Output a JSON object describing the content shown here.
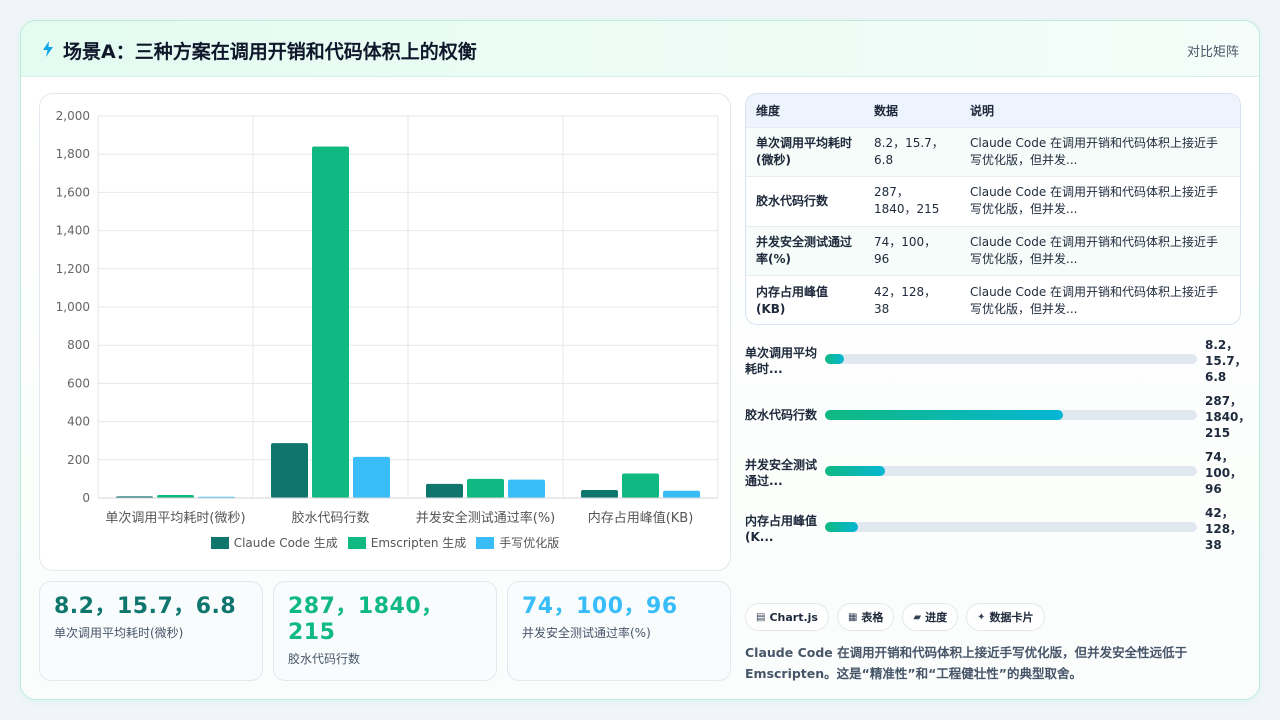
{
  "header": {
    "icon": "lightning-icon",
    "title": "场景A：三种方案在调用开销和代码体积上的权衡",
    "tag": "对比矩阵"
  },
  "colors": {
    "series": [
      "#0f766e",
      "#10b981",
      "#38bdf8"
    ],
    "stat_values": [
      "#0f766e",
      "#10b981",
      "#38bdf8"
    ],
    "accent": "#10b981"
  },
  "chart_data": {
    "type": "bar",
    "categories": [
      "单次调用平均耗时(微秒)",
      "胶水代码行数",
      "并发安全测试通过率(%)",
      "内存占用峰值(KB)"
    ],
    "series": [
      {
        "name": "Claude Code 生成",
        "values": [
          8.2,
          287,
          74,
          42
        ]
      },
      {
        "name": "Emscripten 生成",
        "values": [
          15.7,
          1840,
          100,
          128
        ]
      },
      {
        "name": "手写优化版",
        "values": [
          6.8,
          215,
          96,
          38
        ]
      }
    ],
    "ylim": [
      0,
      2000
    ],
    "yticks": [
      0,
      200,
      400,
      600,
      800,
      1000,
      1200,
      1400,
      1600,
      1800,
      2000
    ],
    "ytick_labels": [
      "0",
      "200",
      "400",
      "600",
      "800",
      "1,000",
      "1,200",
      "1,400",
      "1,600",
      "1,800",
      "2,000"
    ],
    "grid": true,
    "legend": "bottom"
  },
  "stats": [
    {
      "value": "8.2，15.7，6.8",
      "label": "单次调用平均耗时(微秒)"
    },
    {
      "value": "287，1840，215",
      "label": "胶水代码行数"
    },
    {
      "value": "74，100，96",
      "label": "并发安全测试通过率(%)"
    }
  ],
  "table": {
    "headers": [
      "维度",
      "数据",
      "说明"
    ],
    "rows": [
      {
        "dim": "单次调用平均耗时(微秒)",
        "data": "8.2，15.7，6.8",
        "note": "Claude Code 在调用开销和代码体积上接近手写优化版，但并发..."
      },
      {
        "dim": "胶水代码行数",
        "data": "287，1840，215",
        "note": "Claude Code 在调用开销和代码体积上接近手写优化版，但并发..."
      },
      {
        "dim": "并发安全测试通过率(%)",
        "data": "74，100，96",
        "note": "Claude Code 在调用开销和代码体积上接近手写优化版，但并发..."
      },
      {
        "dim": "内存占用峰值(KB)",
        "data": "42，128，38",
        "note": "Claude Code 在调用开销和代码体积上接近手写优化版，但并发..."
      }
    ]
  },
  "progress": [
    {
      "label": "单次调用平均耗时...",
      "value": "8.2，15.7，6.8",
      "fraction": 0.05
    },
    {
      "label": "胶水代码行数",
      "value": "287，1840，215",
      "fraction": 0.64
    },
    {
      "label": "并发安全测试通过...",
      "value": "74，100，96",
      "fraction": 0.16
    },
    {
      "label": "内存占用峰值(K...",
      "value": "42，128，38",
      "fraction": 0.09
    }
  ],
  "chips": [
    {
      "icon": "chart-icon",
      "glyph": "▤",
      "label": "Chart.js"
    },
    {
      "icon": "table-icon",
      "glyph": "▦",
      "label": "表格"
    },
    {
      "icon": "progress-icon",
      "glyph": "▰",
      "label": "进度"
    },
    {
      "icon": "sparkle-icon",
      "glyph": "✦",
      "label": "数据卡片"
    }
  ],
  "summary": "Claude Code 在调用开销和代码体积上接近手写优化版，但并发安全性远低于 Emscripten。这是“精准性”和“工程健壮性”的典型取舍。"
}
